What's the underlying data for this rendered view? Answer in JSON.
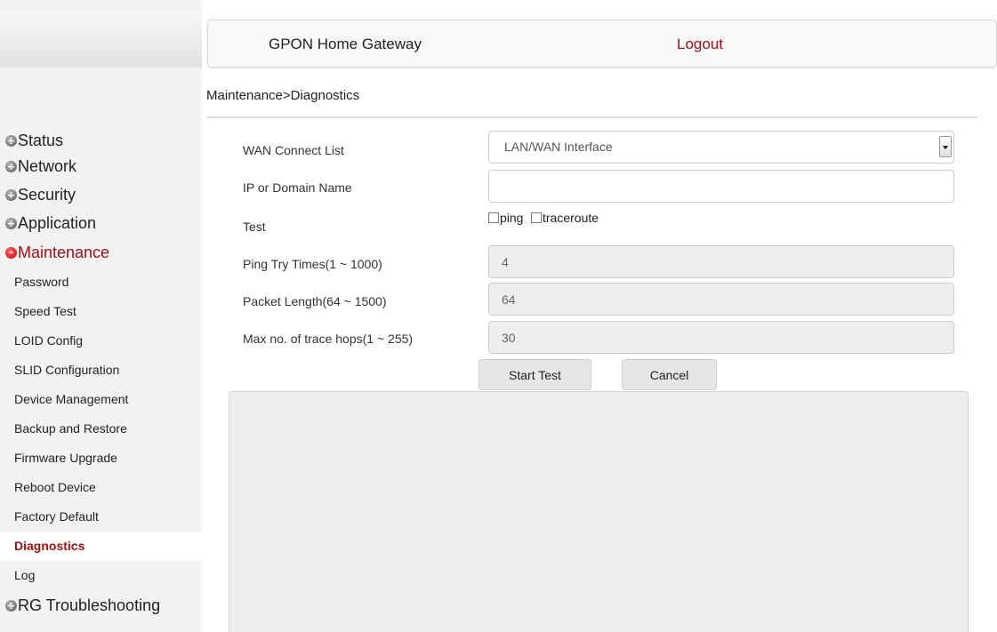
{
  "header": {
    "title": "GPON Home Gateway",
    "logout": "Logout"
  },
  "breadcrumb": "Maintenance>Diagnostics",
  "sidebar": {
    "menus_top": [
      {
        "label": "Status",
        "icon": "plus-circle-icon"
      },
      {
        "label": "Network",
        "icon": "plus-circle-icon"
      },
      {
        "label": "Security",
        "icon": "plus-circle-icon"
      },
      {
        "label": "Application",
        "icon": "plus-circle-icon"
      }
    ],
    "active_menu": {
      "label": "Maintenance",
      "icon": "minus-circle-icon"
    },
    "sub_items": [
      "Password",
      "Speed Test",
      "LOID Config",
      "SLID Configuration",
      "Device Management",
      "Backup and Restore",
      "Firmware Upgrade",
      "Reboot Device",
      "Factory Default",
      "Diagnostics",
      "Log"
    ],
    "selected_sub": "Diagnostics",
    "bottom_menu": {
      "label": "RG Troubleshooting",
      "icon": "plus-circle-icon"
    }
  },
  "form": {
    "wan_label": "WAN Connect List",
    "wan_value": "LAN/WAN Interface",
    "ip_label": "IP or Domain Name",
    "ip_value": "",
    "test_label": "Test",
    "ping_label": "ping",
    "traceroute_label": "traceroute",
    "ping_checked": false,
    "traceroute_checked": false,
    "ping_times_label": "Ping Try Times(1 ~ 1000)",
    "ping_times_value": "4",
    "packet_len_label": "Packet Length(64 ~ 1500)",
    "packet_len_value": "64",
    "max_hops_label": "Max no. of trace hops(1 ~ 255)",
    "max_hops_value": "30"
  },
  "buttons": {
    "start": "Start Test",
    "cancel": "Cancel"
  },
  "result": "",
  "colors": {
    "accent": "#a01014",
    "sidebar_bg": "#f2f2f2",
    "disabled_bg": "#eeeeee"
  }
}
